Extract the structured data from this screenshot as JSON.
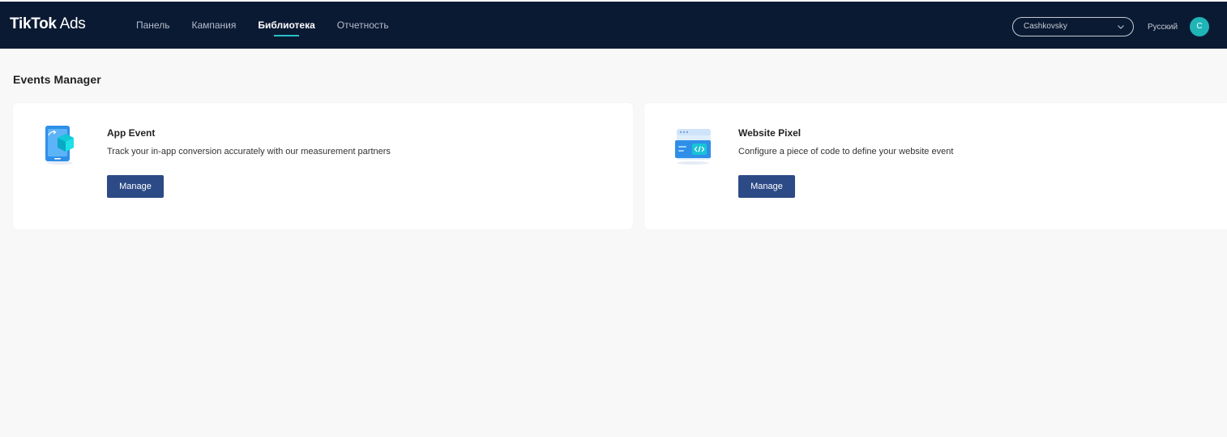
{
  "header": {
    "logo_bold": "TikTok",
    "logo_light": " Ads",
    "nav": [
      {
        "label": "Панель",
        "active": false
      },
      {
        "label": "Кампания",
        "active": false
      },
      {
        "label": "Библиотека",
        "active": true
      },
      {
        "label": "Отчетность",
        "active": false
      }
    ],
    "account": "Cashkovsky",
    "language": "Русский",
    "avatar_initial": "C"
  },
  "page": {
    "title": "Events Manager"
  },
  "cards": [
    {
      "title": "App Event",
      "description": "Track your in-app conversion accurately with our measurement partners",
      "button": "Manage",
      "icon": "app-event-icon"
    },
    {
      "title": "Website Pixel",
      "description": "Configure a piece of code to define your website event",
      "button": "Manage",
      "icon": "website-pixel-icon"
    }
  ],
  "colors": {
    "header_bg": "#0b1a33",
    "accent": "#25c0c8",
    "button": "#2c4a86",
    "page_bg": "#f8f8f8"
  }
}
